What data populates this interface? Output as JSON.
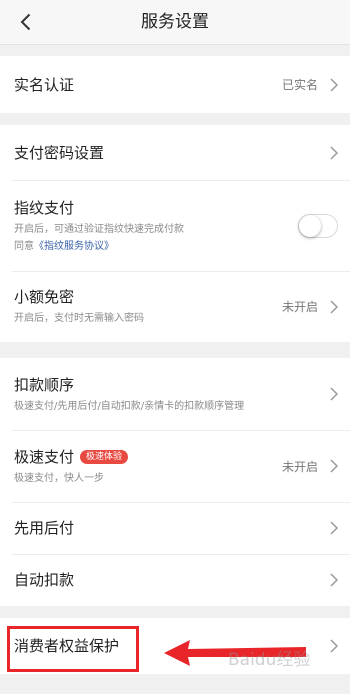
{
  "header": {
    "title": "服务设置",
    "back_icon": "chevron-left-icon"
  },
  "section1": {
    "real_name": {
      "label": "实名认证",
      "value": "已实名"
    }
  },
  "section2": {
    "pay_password": {
      "label": "支付密码设置"
    },
    "fingerprint": {
      "label": "指纹支付",
      "desc": "开启后，可通过验证指纹快速完成付款",
      "agree_prefix": "同意",
      "agree_link": "《指纹服务协议》",
      "toggle_on": false
    },
    "small_free": {
      "label": "小额免密",
      "desc": "开启后，支付时无需输入密码",
      "value": "未开启"
    }
  },
  "section3": {
    "deduct_order": {
      "label": "扣款顺序",
      "desc": "极速支付/先用后付/自动扣款/亲情卡的扣款顺序管理"
    },
    "fast_pay": {
      "label": "极速支付",
      "badge": "极速体验",
      "desc": "极速支付，快人一步",
      "value": "未开启"
    },
    "pay_later": {
      "label": "先用后付"
    },
    "auto_deduct": {
      "label": "自动扣款"
    }
  },
  "section4": {
    "consumer_protection": {
      "label": "消费者权益保护"
    }
  },
  "annotation": {
    "color": "#e8262a"
  },
  "watermark": {
    "text": "Baidu经验"
  }
}
